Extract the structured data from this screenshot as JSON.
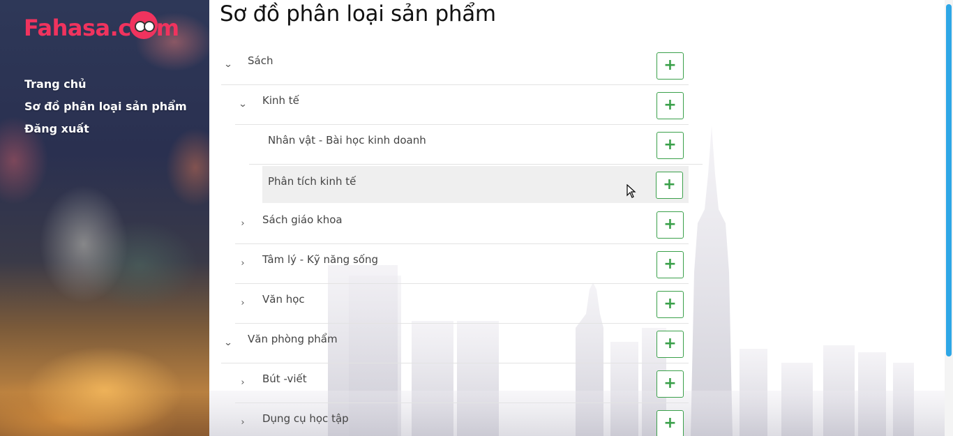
{
  "brand": {
    "logo_text_left": "Fahasa.c",
    "logo_text_right": "m"
  },
  "nav": {
    "items": [
      {
        "label": "Trang chủ"
      },
      {
        "label": "Sơ đồ phân loại sản phẩm"
      },
      {
        "label": "Đăng xuất"
      }
    ]
  },
  "page": {
    "title": "Sơ đồ phân loại sản phẩm"
  },
  "tree": {
    "add_symbol": "+",
    "chevron_down": "⌄",
    "chevron_right": "›",
    "nodes": [
      {
        "label": "Sách",
        "expanded": true
      },
      {
        "label": "Kinh tế",
        "expanded": true
      },
      {
        "label": "Nhân vật - Bài học kinh doanh"
      },
      {
        "label": "Phân tích kinh tế",
        "highlighted": true
      },
      {
        "label": "Sách giáo khoa",
        "expanded": false
      },
      {
        "label": "Tâm lý - Kỹ năng sống",
        "expanded": false
      },
      {
        "label": "Văn học",
        "expanded": false
      },
      {
        "label": "Văn phòng phẩm",
        "expanded": true
      },
      {
        "label": "Bút -viết",
        "expanded": false
      },
      {
        "label": "Dụng cụ học tập",
        "expanded": false
      }
    ]
  },
  "colors": {
    "brand": "#f0335e",
    "add_button": "#3aa04a",
    "scroll_thumb": "#2ea7e6"
  }
}
